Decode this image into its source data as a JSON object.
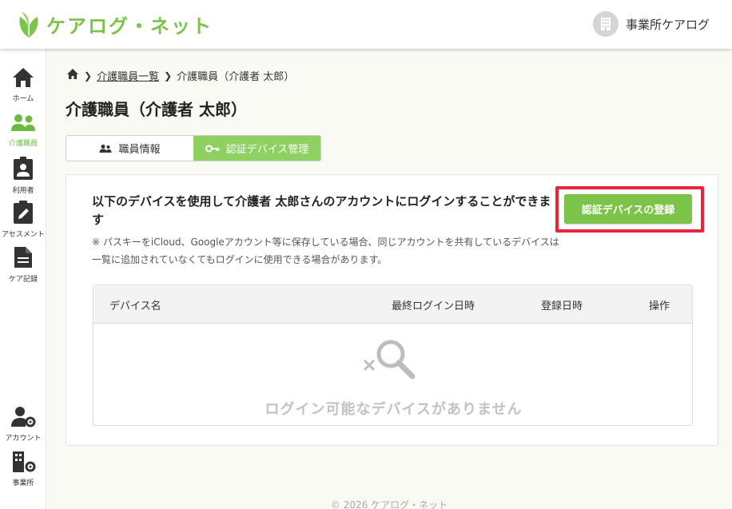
{
  "header": {
    "logo_text": "ケアログ・ネット",
    "office_name": "事業所ケアログ"
  },
  "sidebar": {
    "items": [
      {
        "label": "ホーム",
        "icon": "home-icon"
      },
      {
        "label": "介護職員",
        "icon": "staff-icon",
        "active": true
      },
      {
        "label": "利用者",
        "icon": "user-badge-icon"
      },
      {
        "label": "アセスメント",
        "icon": "assessment-icon"
      },
      {
        "label": "ケア記録",
        "icon": "document-icon"
      },
      {
        "label": "アカウント",
        "icon": "account-settings-icon"
      },
      {
        "label": "事業所",
        "icon": "office-settings-icon"
      }
    ]
  },
  "breadcrumb": {
    "items": [
      "介護職員一覧",
      "介護職員（介護者 太郎）"
    ]
  },
  "page": {
    "title": "介護職員（介護者 太郎）"
  },
  "tabs": [
    {
      "label": "職員情報",
      "icon": "people-icon",
      "active": false
    },
    {
      "label": "認証デバイス管理",
      "icon": "key-icon",
      "active": true
    }
  ],
  "card": {
    "description": "以下のデバイスを使用して介護者 太郎さんのアカウントにログインすることができます",
    "note": "※ パスキーをiCloud、Googleアカウント等に保存している場合、同じアカウントを共有しているデバイスは一覧に追加されていなくてもログインに使用できる場合があります。",
    "register_button": "認証デバイスの登録"
  },
  "table": {
    "columns": [
      "デバイス名",
      "最終ログイン日時",
      "登録日時",
      "操作"
    ],
    "rows": [],
    "empty_text": "ログイン可能なデバイスがありません"
  },
  "footer": {
    "copyright": "© 2026 ケアログ・ネット"
  },
  "colors": {
    "brand_green": "#7cc34a",
    "highlight_red": "#e8253f"
  }
}
